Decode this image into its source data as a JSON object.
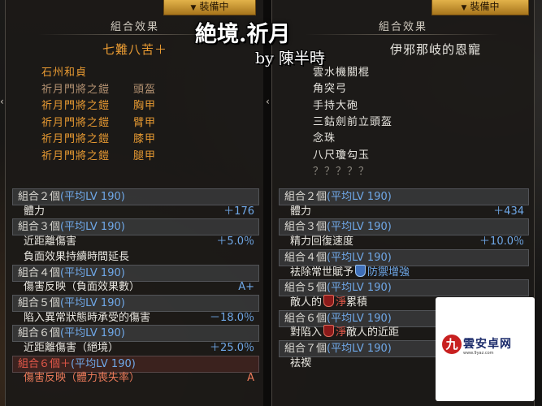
{
  "overlay": {
    "title": "絶境.祈月",
    "byline": "by 陳半時"
  },
  "left": {
    "tab_label": "裝備中",
    "header": "組合效果",
    "set_name": "七難八苦＋",
    "items": [
      {
        "name": "石州和貞",
        "tail": "",
        "style": "orange"
      },
      {
        "name": "祈月門將之鎧",
        "tail": "頭盔",
        "style": "dim"
      },
      {
        "name": "祈月門將之鎧",
        "tail": "胸甲",
        "style": "orange"
      },
      {
        "name": "祈月門將之鎧",
        "tail": "臂甲",
        "style": "orange"
      },
      {
        "name": "祈月門將之鎧",
        "tail": "膝甲",
        "style": "orange"
      },
      {
        "name": "祈月門將之鎧",
        "tail": "腿甲",
        "style": "orange"
      }
    ],
    "bonuses": [
      {
        "kind": "h",
        "count": "組合２個",
        "lv": "(平均LV 190)",
        "red": false
      },
      {
        "kind": "s",
        "label": "體力",
        "value": "＋176"
      },
      {
        "kind": "h",
        "count": "組合３個",
        "lv": "(平均LV 190)",
        "red": false
      },
      {
        "kind": "s",
        "label": "近距離傷害",
        "value": "＋5.0％"
      },
      {
        "kind": "s",
        "label": "負面效果持續時間延長",
        "value": ""
      },
      {
        "kind": "h",
        "count": "組合４個",
        "lv": "(平均LV 190)",
        "red": false
      },
      {
        "kind": "s",
        "label": "傷害反映（負面效果數）",
        "value": "A+"
      },
      {
        "kind": "h",
        "count": "組合５個",
        "lv": "(平均LV 190)",
        "red": false
      },
      {
        "kind": "s",
        "label": "陷入異常狀態時承受的傷害",
        "value": "－18.0％"
      },
      {
        "kind": "h",
        "count": "組合６個",
        "lv": "(平均LV 190)",
        "red": false
      },
      {
        "kind": "s",
        "label": "近距離傷害（絕境）",
        "value": "＋25.0％"
      },
      {
        "kind": "h",
        "count": "組合６個＋",
        "lv": "(平均LV 190)",
        "red": true
      },
      {
        "kind": "sr",
        "label": "傷害反映（體力喪失率）",
        "value": "A"
      }
    ]
  },
  "right": {
    "tab_label": "裝備中",
    "header": "組合效果",
    "set_name": "伊邪那岐的恩寵",
    "items": [
      {
        "name": "雲水機關棍",
        "style": "white"
      },
      {
        "name": "角突弓",
        "style": "white"
      },
      {
        "name": "手持大砲",
        "style": "white"
      },
      {
        "name": "三鈷劍前立頭盔",
        "style": "white"
      },
      {
        "name": "念珠",
        "style": "white"
      },
      {
        "name": "八尺瓊勾玉",
        "style": "white"
      },
      {
        "name": "？？？？？",
        "style": "grey"
      }
    ],
    "bonuses": [
      {
        "kind": "h",
        "count": "組合２個",
        "lv": "(平均LV 190)"
      },
      {
        "kind": "s",
        "label": "體力",
        "value": "＋434"
      },
      {
        "kind": "h",
        "count": "組合３個",
        "lv": "(平均LV 190)"
      },
      {
        "kind": "s",
        "label": "精力回復速度",
        "value": "＋10.0％"
      },
      {
        "kind": "h",
        "count": "組合４個",
        "lv": "(平均LV 190)"
      },
      {
        "kind": "s",
        "label": "袪除常世賦予",
        "icon": "shield-blue",
        "label2": "防禦增強",
        "value": ""
      },
      {
        "kind": "h",
        "count": "組合５個",
        "lv": "(平均LV 190)"
      },
      {
        "kind": "s",
        "label": "敵人的",
        "icon": "shield-red",
        "label2": "淨",
        "label3": "累積",
        "value": ""
      },
      {
        "kind": "h",
        "count": "組合６個",
        "lv": "(平均LV 190)"
      },
      {
        "kind": "s",
        "label": "對陷入",
        "icon": "shield-red",
        "label2": "淨",
        "label3": "敵人的近距",
        "value": ""
      },
      {
        "kind": "h",
        "count": "組合７個",
        "lv": "(平均LV 190)"
      },
      {
        "kind": "s",
        "label": "袪禊",
        "value": ""
      }
    ]
  },
  "watermark": {
    "mark": "九",
    "name": "雲安卓网",
    "url": "www.9yaz.com"
  },
  "colors": {
    "tab_gold": "#d7a23c",
    "orange": "#e89a32",
    "blue": "#6fa8e8",
    "red": "#e4584a"
  }
}
